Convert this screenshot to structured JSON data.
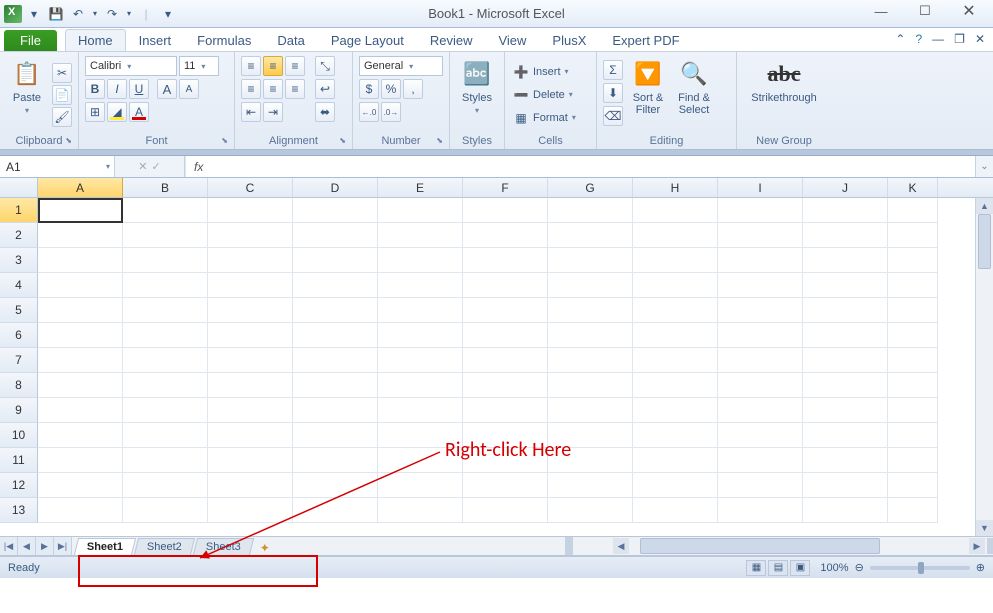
{
  "title": "Book1 - Microsoft Excel",
  "qat": {
    "save": "💾",
    "undo": "↶",
    "redo": "↷"
  },
  "tabs": {
    "file": "File",
    "items": [
      "Home",
      "Insert",
      "Formulas",
      "Data",
      "Page Layout",
      "Review",
      "View",
      "PlusX",
      "Expert PDF"
    ],
    "active": "Home"
  },
  "ribbon": {
    "clipboard": {
      "label": "Clipboard",
      "paste": "Paste",
      "cut": "✂",
      "copy": "📄",
      "fmt": "🖌"
    },
    "font": {
      "label": "Font",
      "name": "Calibri",
      "size": "11",
      "bold": "B",
      "italic": "I",
      "underline": "U",
      "grow": "A",
      "shrink": "A",
      "border": "⊞",
      "fill": "◢",
      "color": "A"
    },
    "alignment": {
      "label": "Alignment",
      "top": "≡",
      "mid": "≡",
      "bot": "≡",
      "left": "≡",
      "center": "≡",
      "right": "≡",
      "wrap": "↩",
      "merge": "⬌",
      "indL": "⇤",
      "indR": "⇥",
      "orient": "⤡"
    },
    "number": {
      "label": "Number",
      "format": "General",
      "currency": "$",
      "percent": "%",
      "comma": ",",
      "inc": ".00→.0",
      "dec": ".0→.00"
    },
    "styles": {
      "label": "Styles",
      "btn": "Styles"
    },
    "cells": {
      "label": "Cells",
      "insert": "Insert",
      "delete": "Delete",
      "format": "Format"
    },
    "editing": {
      "label": "Editing",
      "sum": "Σ",
      "fill": "⬇",
      "clear": "⌫",
      "sort": "Sort &\nFilter",
      "find": "Find &\nSelect"
    },
    "newgroup": {
      "label": "New Group",
      "strike": "Strikethrough"
    }
  },
  "formula": {
    "namebox": "A1",
    "fx": "fx",
    "value": ""
  },
  "columns": [
    "A",
    "B",
    "C",
    "D",
    "E",
    "F",
    "G",
    "H",
    "I",
    "J",
    "K"
  ],
  "rows": [
    "1",
    "2",
    "3",
    "4",
    "5",
    "6",
    "7",
    "8",
    "9",
    "10",
    "11",
    "12",
    "13"
  ],
  "active_cell": "A1",
  "sheets": {
    "items": [
      "Sheet1",
      "Sheet2",
      "Sheet3"
    ],
    "active": "Sheet1"
  },
  "status": {
    "ready": "Ready",
    "zoom": "100%"
  },
  "annotation": {
    "text": "Right-click Here"
  }
}
